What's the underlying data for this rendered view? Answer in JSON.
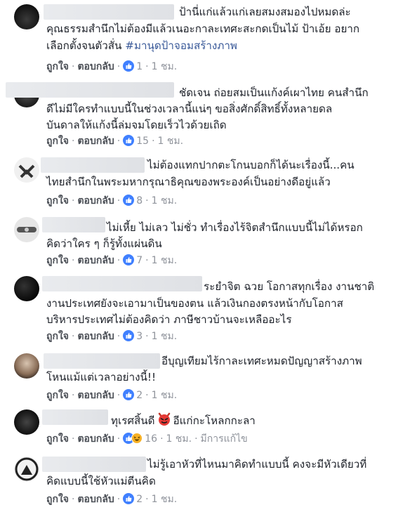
{
  "actions": {
    "like": "ถูกใจ",
    "reply": "ตอบกลับ",
    "dot": "·"
  },
  "comments": [
    {
      "lines": [
        "ป้านี่แก่แล้วแก่เลยสมงสมองไปหมดล่ะ",
        "คุณธรรมสำนึกไม่ต้องมีแล้วเนอะกาละเทศะสะกดเป็นไม้ ป้าเอ้ย อยาก",
        "เลือกตั้งจนตัวสั่น "
      ],
      "hashtag": "#มานุดป้าจอมสร้างภาพ",
      "reactions": "1",
      "time": "1 ชม."
    },
    {
      "lines": [
        "ชัดเจน ถ่อยสมเป็นแก้งค์เผาไทย คนสำนึก",
        "ดีไม่มีใครทำแบบนี้ในช่วงเวลานี้แน่ๆ ขอสิ่งศักดิ์สิทธิ์ทั้งหลายดล",
        "บันดาลให้แก้งนี้ล่มจมโดยเร็วไวด้วยเถิด"
      ],
      "reactions": "15",
      "time": "1 ชม."
    },
    {
      "lines": [
        "ไม่ต้องแทกปากตะโกนบอกก็ได้นะเรื่องนี้...คน",
        "ไทยสำนึกในพระมหากรุณาธิคุณของพระองค์เป็นอย่างดีอยู่แล้ว"
      ],
      "reactions": "8",
      "time": "1 ชม."
    },
    {
      "lines": [
        "ไม่เหี้ย ไม่เลว ไม่ชั่ว ทำเรื่องไร้จิตสำนึกแบบนี้ไม่ได้หรอก",
        "คิดว่าใคร ๆ ก็รู้ทั้งแผ่นดิน"
      ],
      "reactions": "7",
      "time": "1 ชม."
    },
    {
      "lines": [
        "ระยำจิต ฉวย โอกาสทุกเรื่อง งานชาติ",
        "งานประเทศยังจะเอามาเป็นของตน แล้วเงินกองตรงหน้ากับโอกาส",
        "บริหารประเทศไม่ต้องคิดว่า ภาษีชาวบ้านจะเหลืออะไร"
      ],
      "reactions": "3",
      "time": "1 ชม."
    },
    {
      "lines": [
        "อีบุญเทียมไร้กาละเทศะหมดปัญญาสร้างภาพ",
        "โหนแม้แต่เวลาอย่างนี้!!"
      ],
      "reactions": "2",
      "time": "1 ชม."
    },
    {
      "text_before": "ทุเรศสิ้นดี",
      "emoji": "devil-face",
      "text_after": "อีแก่กะโหลกกะลา",
      "reactions": "16",
      "time": "1 ชม.",
      "edited": "มีการแก้ไข"
    },
    {
      "lines": [
        "ไม่รู้เอาหัวที่ไหนมาคิดทำแบบนี้ คงจะมีหัวเดียวที่",
        "คิดแบบนี้ใช้หัวแม่ตีนคิด"
      ],
      "reactions": "2",
      "time": "1 ชม."
    }
  ],
  "colors": {
    "like_blue": "#4080ff",
    "haha_yellow": "#f7b125",
    "link_blue": "#385898"
  }
}
